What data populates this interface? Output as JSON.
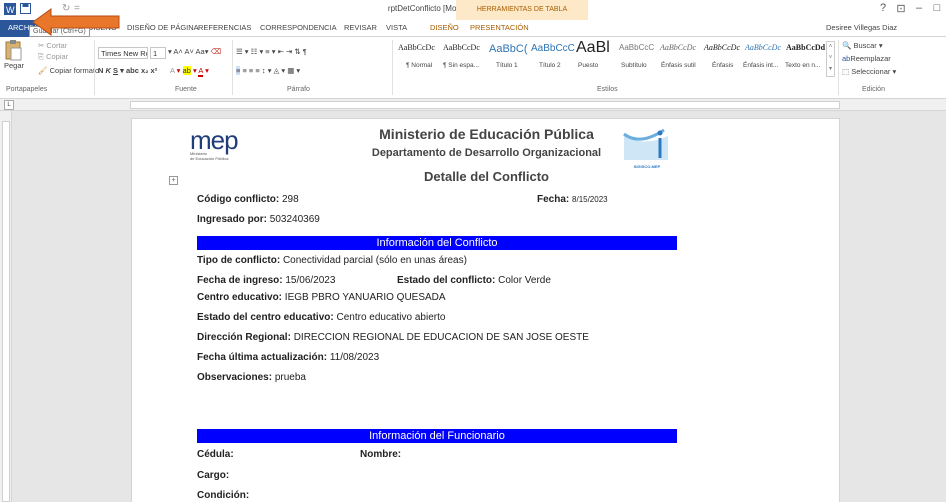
{
  "window": {
    "title": "rptDetConflicto [Modo de compatibilidad] - Word",
    "context_group": "HERRAMIENTAS DE TABLA",
    "controls": [
      "?",
      "⊡",
      "–",
      "□"
    ]
  },
  "tabs": {
    "file": "ARCHIVO",
    "items": [
      "DISEÑO",
      "DISEÑO DE PÁGINA",
      "REFERENCIAS",
      "CORRESPONDENCIA",
      "REVISAR",
      "VISTA"
    ],
    "context_items": [
      "DISEÑO",
      "PRESENTACIÓN"
    ],
    "user": "Desiree Villegas Diaz"
  },
  "tooltip": "Guardar (Ctrl+G)",
  "clipboard": {
    "paste": "Pegar",
    "cut": "Cortar",
    "copy": "Copiar",
    "format_painter": "Copiar formato",
    "group": "Portapapeles"
  },
  "font": {
    "name": "Times New Ro",
    "size": "1",
    "group": "Fuente"
  },
  "paragraph": {
    "group": "Párrafo"
  },
  "styles": {
    "group": "Estilos",
    "items": [
      {
        "sample": "AaBbCcDc",
        "label": "¶ Normal"
      },
      {
        "sample": "AaBbCcDc",
        "label": "¶ Sin espa..."
      },
      {
        "sample": "AaBbC(",
        "label": "Título 1"
      },
      {
        "sample": "AaBbCcC",
        "label": "Título 2"
      },
      {
        "sample": "AaBl",
        "label": "Puesto"
      },
      {
        "sample": "AaBbCcC",
        "label": "Subtítulo"
      },
      {
        "sample": "AaBbCcDc",
        "label": "Énfasis sutil"
      },
      {
        "sample": "AaBbCcDc",
        "label": "Énfasis"
      },
      {
        "sample": "AaBbCcDc",
        "label": "Énfasis int..."
      },
      {
        "sample": "AaBbCcDd",
        "label": "Texto en n..."
      }
    ]
  },
  "editing": {
    "find": "Buscar",
    "replace": "Reemplazar",
    "select": "Seleccionar",
    "group": "Edición"
  },
  "document": {
    "org_title": "Ministerio de Educación Pública",
    "dept_title": "Departamento de Desarrollo Organizacional",
    "report_title": "Detalle del Conflicto",
    "mep_logo_text": "mep",
    "mep_logo_sub1": "Ministerio",
    "mep_logo_sub2": "de Educación Pública",
    "sigisco_text": "SIGISCO-MEP",
    "codigo_label": "Código conflicto:",
    "codigo_value": "298",
    "fecha_label": "Fecha:",
    "fecha_value": "8/15/2023",
    "ingresado_label": "Ingresado por:",
    "ingresado_value": "503240369",
    "section1": "Información del Conflicto",
    "tipo_label": "Tipo de conflicto:",
    "tipo_value": "Conectividad parcial (sólo en unas áreas)",
    "fecha_ingreso_label": "Fecha de ingreso:",
    "fecha_ingreso_value": "15/06/2023",
    "estado_label": "Estado del conflicto:",
    "estado_value": "Color Verde",
    "centro_label": "Centro educativo:",
    "centro_value": "IEGB PBRO YANUARIO QUESADA",
    "estado_centro_label": "Estado del centro educativo:",
    "estado_centro_value": "Centro educativo abierto",
    "direccion_label": "Dirección Regional:",
    "direccion_value": "DIRECCION REGIONAL DE EDUCACION DE SAN JOSE OESTE",
    "actualizacion_label": "Fecha última actualización:",
    "actualizacion_value": "11/08/2023",
    "observaciones_label": "Observaciones:",
    "observaciones_value": "prueba",
    "section2": "Información del Funcionario",
    "cedula_label": "Cédula:",
    "nombre_label": "Nombre:",
    "cargo_label": "Cargo:",
    "condicion_label": "Condición:"
  },
  "colors": {
    "file_tab": "#2b579a",
    "section_bar": "#0000ff",
    "annotation_arrow": "#e8762b"
  }
}
